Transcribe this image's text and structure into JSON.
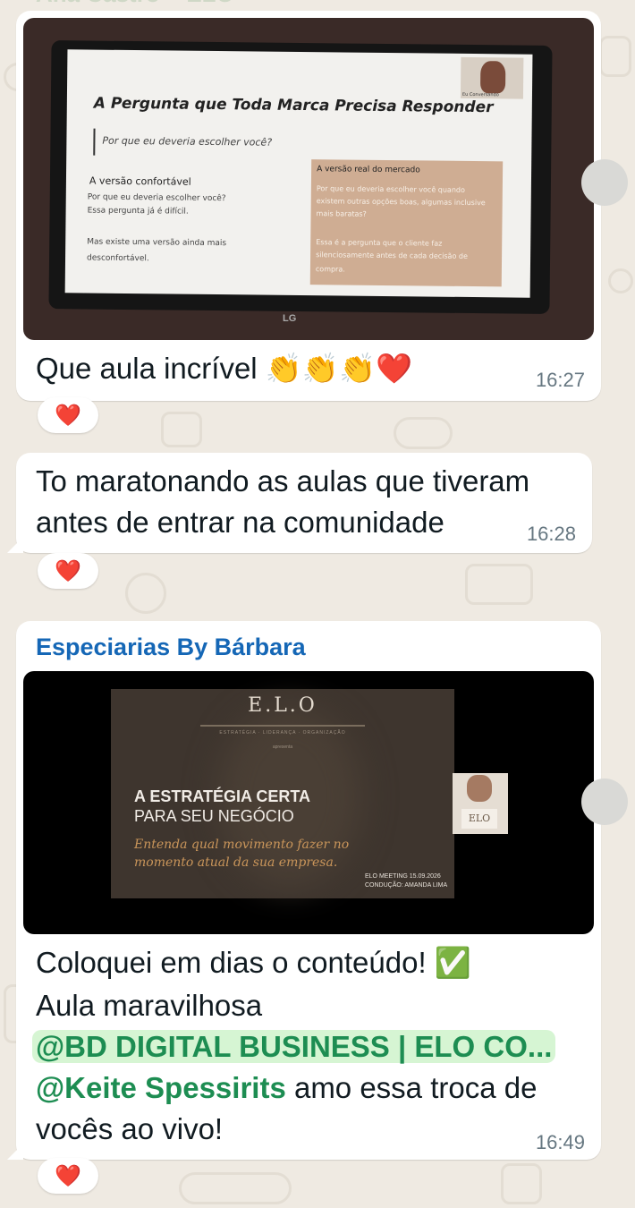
{
  "top_partial_sender": "Ana Castro ~ ELO",
  "messages": [
    {
      "slide": {
        "title": "A Pergunta que Toda Marca Precisa Responder",
        "subtitle": "Por que eu deveria escolher você?",
        "comfortable_heading": "A versão confortável",
        "comfortable_line1": "Por que eu deveria escolher você?",
        "comfortable_line2": "Essa pergunta já é difícil.",
        "more_line1": "Mas existe uma versão ainda mais",
        "more_line2": "desconfortável.",
        "real_heading": "A versão real do mercado",
        "real_line1": "Por que eu deveria escolher você quando",
        "real_line2": "existem outras opções boas, algumas inclusive",
        "real_line3": "mais baratas?",
        "real_line4": "Essa é a pergunta que o cliente faz",
        "real_line5": "silenciosamente antes de cada decisão de",
        "real_line6": "compra.",
        "cam_label": "Eu Conversando",
        "brand": "LG"
      },
      "text": "Que aula incrível 👏👏👏❤️",
      "time": "16:27",
      "reaction": "❤️"
    },
    {
      "text_line1": "To maratonando as aulas que tiveram",
      "text_line2": "antes de entrar na comunidade",
      "time": "16:28",
      "reaction": "❤️"
    },
    {
      "sender": "Especiarias By Bárbara",
      "slide": {
        "logo": "E.L.O",
        "tagline": "ESTRATÉGIA · LIDERANÇA · ORGANIZAÇÃO",
        "kicker": "apresenta",
        "title_line1": "A ESTRATÉGIA CERTA",
        "title_line2": "PARA SEU NEGÓCIO",
        "subtitle_line1": "Entenda qual movimento fazer no",
        "subtitle_line2": "momento atual da sua empresa.",
        "meta_line1": "ELO MEETING 15.09.2026",
        "meta_line2": "CONDUÇÃO: AMANDA LIMA",
        "cam_logo": "ELO"
      },
      "text_line1": "Coloquei em dias o conteúdo! ✅",
      "text_line2": "Aula maravilhosa",
      "mention1": "@BD DIGITAL BUSINESS | ELO CO...",
      "mention2": "@Keite Spessirits",
      "text_line3_rest": " amo essa troca de",
      "text_line4": "vocês ao vivo!",
      "time": "16:49",
      "reaction": "❤️"
    }
  ]
}
